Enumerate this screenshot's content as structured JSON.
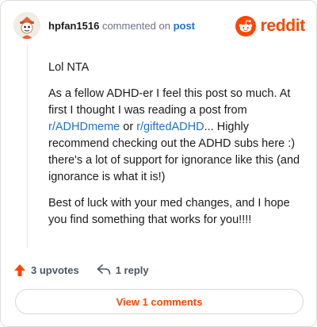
{
  "header": {
    "username": "hpfan1516",
    "action_text": "commented on",
    "post_link": "post"
  },
  "brand": {
    "wordmark": "reddit",
    "logo_icon": "reddit-alien-icon",
    "color": "#ff4500"
  },
  "comment": {
    "paragraphs": [
      "Lol NTA",
      "",
      "Best of luck with your med changes, and I hope you find something that works for you!!!!"
    ],
    "p2_part1": "As a fellow ADHD-er I feel this post so much. At first I thought I was reading a post from ",
    "p2_link1": "r/ADHDmeme",
    "p2_part2": " or ",
    "p2_link2": "r/giftedADHD",
    "p2_part3": "... Highly recommend checking out the ADHD subs here :) there's a lot of support for ignorance like this (and ignorance is what it is!)"
  },
  "actions": {
    "upvotes": "3 upvotes",
    "upvote_icon": "upvote-arrow-icon",
    "replies": "1 reply",
    "reply_icon": "reply-arrow-icon"
  },
  "view_button": {
    "label": "View 1 comments"
  },
  "colors": {
    "accent": "#ff4500",
    "link": "#1f6fcf"
  }
}
